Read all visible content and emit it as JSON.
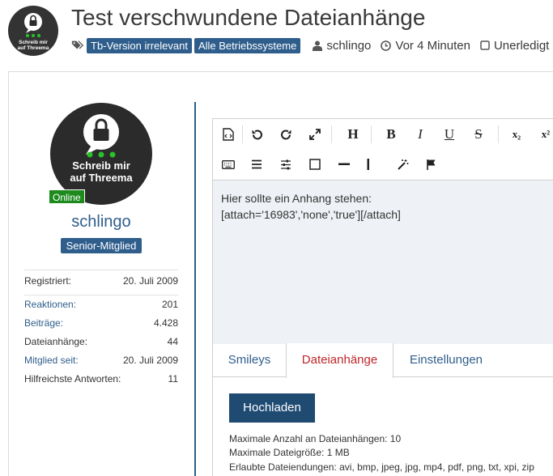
{
  "topic": {
    "title": "Test verschwundene Dateianhänge",
    "labels": [
      "Tb-Version irrelevant",
      "Alle Betriebssysteme"
    ],
    "author": "schlingo",
    "time": "Vor 4 Minuten",
    "status": "Unerledigt"
  },
  "avatar": {
    "line1": "Schreib mir",
    "line2": "auf Threema"
  },
  "user": {
    "online": "Online",
    "name": "schlingo",
    "rank": "Senior-Mitglied",
    "registered_label": "Registriert:",
    "registered_value": "20. Juli 2009",
    "stats": [
      {
        "label": "Reaktionen:",
        "value": "201",
        "link": true
      },
      {
        "label": "Beiträge:",
        "value": "4.428",
        "link": true
      },
      {
        "label": "Dateianhänge:",
        "value": "44",
        "link": false
      },
      {
        "label": "Mitglied seit:",
        "value": "20. Juli 2009",
        "link": true
      },
      {
        "label": "Hilfreichste Antworten:",
        "value": "11",
        "link": false
      }
    ]
  },
  "editor": {
    "line1": "Hier sollte ein Anhang stehen:",
    "line2": "[attach='16983','none','true'][/attach]",
    "toolbar": {
      "heading": "H",
      "bold": "B",
      "italic": "I",
      "underline": "U",
      "strike": "S",
      "sub": "x₂",
      "sup": "x²"
    }
  },
  "tabs": [
    "Smileys",
    "Dateianhänge",
    "Einstellungen"
  ],
  "active_tab": "Dateianhänge",
  "attachments": {
    "upload_label": "Hochladen",
    "max_count": "Maximale Anzahl an Dateianhängen: 10",
    "max_size": "Maximale Dateigröße: 1 MB",
    "allowed": "Erlaubte Dateiendungen: avi, bmp, jpeg, jpg, mp4, pdf, png, txt, xpi, zip"
  },
  "colors": {
    "brand": "#2f5e8c",
    "online": "#1d8a1d",
    "active_tab": "#c0262c",
    "upload": "#1f4b73"
  }
}
